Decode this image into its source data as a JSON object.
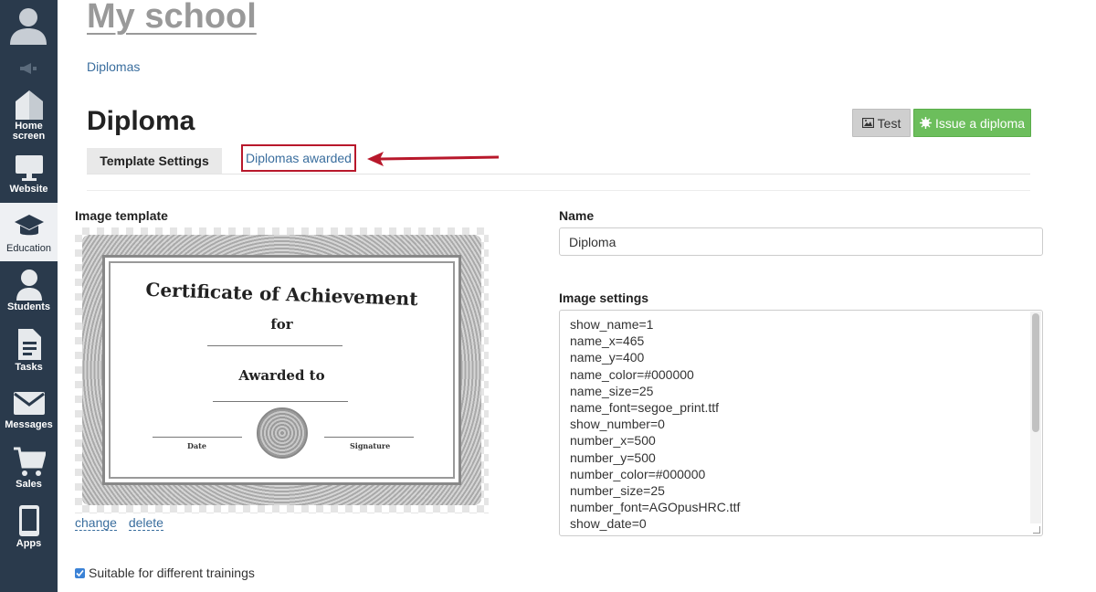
{
  "sidebar": {
    "items": [
      {
        "label": "Home screen",
        "icon": "home-icon"
      },
      {
        "label": "Website",
        "icon": "monitor-icon"
      },
      {
        "label": "Education",
        "icon": "graduation-cap-icon",
        "active": true
      },
      {
        "label": "Students",
        "icon": "person-icon"
      },
      {
        "label": "Tasks",
        "icon": "document-icon"
      },
      {
        "label": "Messages",
        "icon": "envelope-icon"
      },
      {
        "label": "Sales",
        "icon": "cart-icon"
      },
      {
        "label": "Apps",
        "icon": "phone-icon"
      }
    ]
  },
  "header": {
    "school_title": "My school",
    "breadcrumb": "Diplomas",
    "page_title": "Diploma"
  },
  "actions": {
    "test_label": "Test",
    "issue_label": "Issue a diploma"
  },
  "tabs": {
    "settings": "Template Settings",
    "awarded": "Diplomas awarded"
  },
  "template": {
    "label": "Image template",
    "cert_title": "Certificate of Achievement",
    "cert_for": "for",
    "cert_awarded": "Awarded to",
    "cert_date": "Date",
    "cert_signature": "Signature",
    "change_label": "change",
    "delete_label": "delete"
  },
  "form": {
    "name_label": "Name",
    "name_value": "Diploma",
    "settings_label": "Image settings",
    "settings_lines": [
      "show_name=1",
      "name_x=465",
      "name_y=400",
      "name_color=#000000",
      "name_size=25",
      "name_font=segoe_print.ttf",
      "show_number=0",
      "number_x=500",
      "number_y=500",
      "number_color=#000000",
      "number_size=25",
      "number_font=AGOpusHRC.ttf",
      "show_date=0"
    ],
    "checkbox_label": "Suitable for different trainings"
  },
  "colors": {
    "sidebar_bg": "#2a3a4c",
    "link": "#3a6e9e",
    "issue_button": "#6cbe5c",
    "highlight": "#b8182b"
  }
}
